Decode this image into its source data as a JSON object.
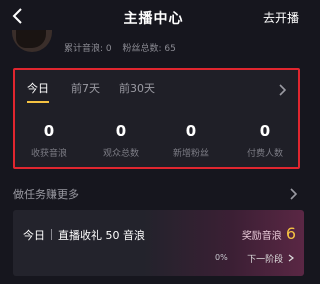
{
  "nav": {
    "title": "主播中心",
    "action_label": "去开播"
  },
  "profile": {
    "stats": [
      {
        "text": "累计音浪: 0"
      },
      {
        "text": "粉丝总数: 65"
      }
    ]
  },
  "stats_card": {
    "tabs": [
      {
        "label": "今日",
        "active": true
      },
      {
        "label": "前7天",
        "active": false
      },
      {
        "label": "前30天",
        "active": false
      }
    ],
    "metrics": [
      {
        "value": "0",
        "label": "收获音浪"
      },
      {
        "value": "0",
        "label": "观众总数"
      },
      {
        "value": "0",
        "label": "新增粉丝"
      },
      {
        "value": "0",
        "label": "付费人数"
      }
    ],
    "accent_color": "#f5c242",
    "highlight_border_color": "#e0262f"
  },
  "more_tasks": {
    "label": "做任务赚更多"
  },
  "task": {
    "day": "今日",
    "title": "直播收礼 50 音浪",
    "reward_label": "奖励音浪",
    "reward_value": "6",
    "progress_text": "0%",
    "progress": 0,
    "next_label": "下一阶段"
  }
}
